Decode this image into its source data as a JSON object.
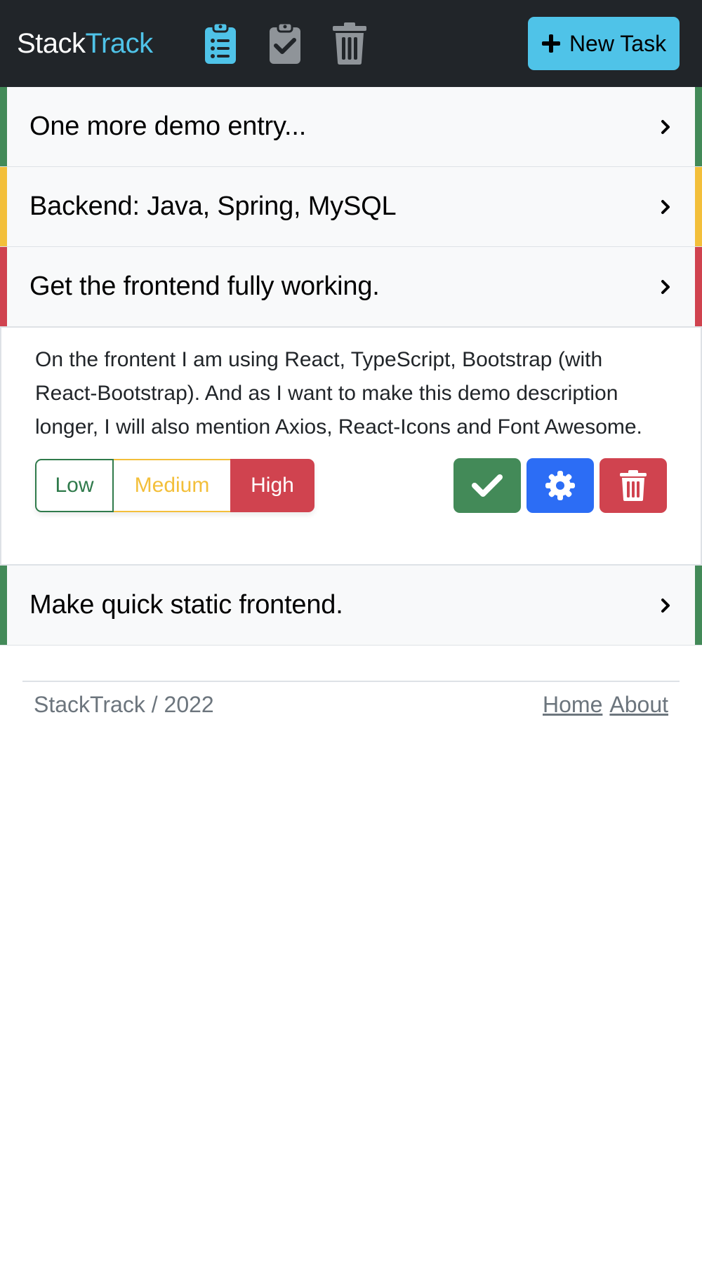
{
  "navbar": {
    "brand_part1": "Stack",
    "brand_part2": "Track",
    "icons": [
      "clipboard-list-icon",
      "clipboard-check-icon",
      "trash-icon"
    ],
    "new_task_label": "New Task",
    "accent_color": "#4fc3e8"
  },
  "tasks": [
    {
      "title": "One more demo entry...",
      "priority_color": "#438a58"
    },
    {
      "title": "Backend: Java, Spring, MySQL",
      "priority_color": "#f3bf3a"
    },
    {
      "title": "Get the frontend fully working.",
      "priority_color": "#d0434f"
    },
    {
      "title": "Make quick static frontend.",
      "priority_color": "#438a58"
    }
  ],
  "expanded": {
    "description": "On the frontent I am using React, TypeScript, Bootstrap (with React-Bootstrap). And as I want to make this demo description longer, I will also mention Axios, React-Icons and Font Awesome.",
    "priority_options": [
      "Low",
      "Medium",
      "High"
    ],
    "selected_priority": "High"
  },
  "footer": {
    "text": "StackTrack / 2022",
    "links": [
      "Home",
      "About"
    ]
  }
}
